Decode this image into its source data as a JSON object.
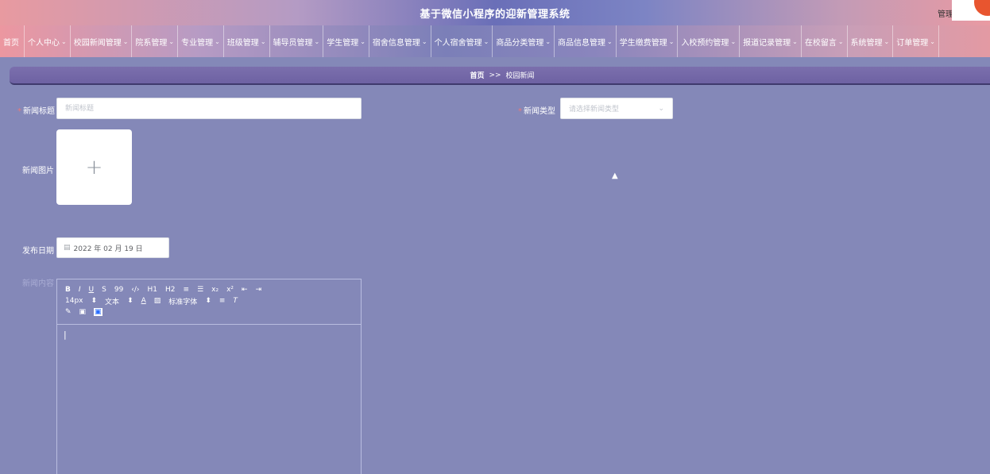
{
  "app": {
    "title": "基于微信小程序的迎新管理系统",
    "user_label": "管理员"
  },
  "nav": {
    "items": [
      {
        "label": "首页",
        "has_menu": false
      },
      {
        "label": "个人中心",
        "has_menu": true
      },
      {
        "label": "校园新闻管理",
        "has_menu": true
      },
      {
        "label": "院系管理",
        "has_menu": true
      },
      {
        "label": "专业管理",
        "has_menu": true
      },
      {
        "label": "班级管理",
        "has_menu": true
      },
      {
        "label": "辅导员管理",
        "has_menu": true
      },
      {
        "label": "学生管理",
        "has_menu": true
      },
      {
        "label": "宿舍信息管理",
        "has_menu": true
      },
      {
        "label": "个人宿舍管理",
        "has_menu": true
      },
      {
        "label": "商品分类管理",
        "has_menu": true
      },
      {
        "label": "商品信息管理",
        "has_menu": true
      },
      {
        "label": "学生缴费管理",
        "has_menu": true
      },
      {
        "label": "入校预约管理",
        "has_menu": true
      },
      {
        "label": "报道记录管理",
        "has_menu": true
      },
      {
        "label": "在校留言",
        "has_menu": true
      },
      {
        "label": "系统管理",
        "has_menu": true
      },
      {
        "label": "订单管理",
        "has_menu": true
      }
    ]
  },
  "breadcrumb": {
    "home": "首页",
    "sep": ">>",
    "current": "校园新闻"
  },
  "form": {
    "title_label": "新闻标题",
    "title_placeholder": "新闻标题",
    "type_label": "新闻类型",
    "type_placeholder": "请选择新闻类型",
    "image_label": "新闻图片",
    "date_label": "发布日期",
    "date_value": "2022 年 02 月 19 日",
    "content_label": "新闻内容"
  },
  "editor": {
    "row1": [
      "B",
      "I",
      "U",
      "S",
      "99",
      "‹/›",
      "H1",
      "H2",
      "≡",
      "☰",
      "x₂",
      "x²",
      "⇤",
      "⇥"
    ],
    "font_size": "14px",
    "text_style": "文本",
    "font_family": "标准字体",
    "content": "|"
  },
  "colors": {
    "page_bg": "#8488b8",
    "breadcrumb_bg": "#7b6fad",
    "required": "#e87a7a"
  }
}
